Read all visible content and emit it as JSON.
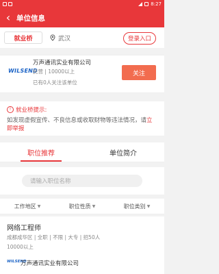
{
  "status_bar": {
    "time": "8:27"
  },
  "appbar": {
    "title": "单位信息"
  },
  "searchbar": {
    "logo_text": "就业桥",
    "city": "武汉",
    "login_label": "登录入口"
  },
  "company": {
    "logo_text": "WILSEND",
    "name": "万声通讯实业有限公司",
    "meta": "民营 | 10000以上",
    "followers": "已有0人关注该单位",
    "follow_label": "关注"
  },
  "notice": {
    "title": "就业桥提示:",
    "text": "如发现虚假宣传、不良信息或收取财物等违法情况，请",
    "link": "立即举报"
  },
  "tabs": [
    {
      "label": "职位推荐",
      "active": true
    },
    {
      "label": "单位简介",
      "active": false
    }
  ],
  "job_search": {
    "placeholder": "请输入职位名称"
  },
  "filters": [
    {
      "label": "工作地区"
    },
    {
      "label": "职位性质"
    },
    {
      "label": "职位类别"
    }
  ],
  "job": {
    "title": "网络工程师",
    "meta": "成都成华区 | 全职 | 不限 | 大专 | 招50人",
    "salary": "10000以上",
    "company_logo": "WILSEND",
    "company": "万声通讯实业有限公司"
  },
  "colors": {
    "accent": "#e8373a",
    "follow_button": "#f26c4f"
  }
}
